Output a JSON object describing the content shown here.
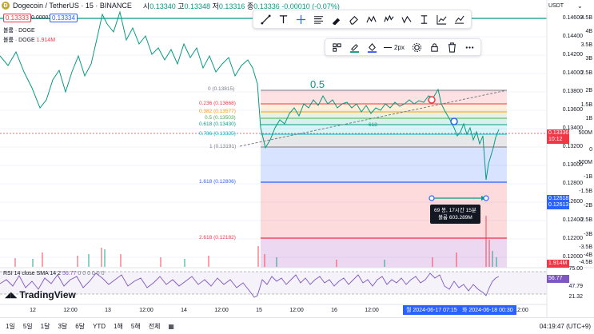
{
  "header": {
    "symbol": "Dogecoin / TetherUS · 15 · BINANCE",
    "open_lbl": "시",
    "open": "0.13340",
    "high_lbl": "고",
    "high": "0.13348",
    "low_lbl": "저",
    "low": "0.13316",
    "close_lbl": "종",
    "close": "0.13336",
    "change": "-0.00010 (-0.07%)",
    "currency": "USDT"
  },
  "prices": {
    "bid": "0.13333",
    "spread": "0.00001",
    "ask": "0.13334"
  },
  "volume_legend": {
    "label1": "볼륨 · DOGE",
    "label2": "볼륨 · DOGE",
    "value": "1.914M"
  },
  "fib_center_label": "0.5",
  "fib_levels": [
    {
      "text": "0 (0.13815)"
    },
    {
      "text": "0.236 (0.13668)"
    },
    {
      "text": "0.382 (0.13577)"
    },
    {
      "text": "0.5 (0.13503)"
    },
    {
      "text": "0.618 (0.13430)"
    },
    {
      "text": "0.786 (0.13325)"
    },
    {
      "text": "1 (0.13191)"
    },
    {
      "text": "1.618 (0.12806)"
    },
    {
      "text": "2.618 (0.12182)"
    }
  ],
  "trend_label": "618",
  "price_axis": [
    "0.14600",
    "0.14400",
    "0.14200",
    "0.14000",
    "0.13800",
    "0.13600",
    "0.13400",
    "0.13200",
    "0.13000",
    "0.12800",
    "0.12600",
    "0.12400",
    "0.12200",
    "0.12000"
  ],
  "volume_axis": [
    "4.5B",
    "4B",
    "3.5B",
    "3B",
    "2.5B",
    "2B",
    "1.5B",
    "1B",
    "500M",
    "0",
    "-500M",
    "-1B",
    "-1.5B",
    "-2B",
    "-2.5B",
    "-3B",
    "-3.5B",
    "-4B",
    "-4.5B"
  ],
  "current_price": {
    "value": "0.13336",
    "countdown": "10:12"
  },
  "range_prices": {
    "top": "0.12618",
    "bottom": "0.12613"
  },
  "volume_tag": "1.914M",
  "measure": {
    "line1": "69 봉, 17시간 15분",
    "line2": "볼륨 603.289M"
  },
  "rsi": {
    "legend": "RSI 14 close SMA 14 2",
    "value": "56.77",
    "zeros": "0  0  0  0  0  0",
    "axis": [
      "75.00",
      "47.79",
      "21.32"
    ],
    "tag": "56.77"
  },
  "x_axis": [
    "12",
    "12:00",
    "13",
    "12:00",
    "14",
    "12:00",
    "15",
    "12:00",
    "16",
    "12:00",
    "12:00"
  ],
  "x_range": {
    "start": "월 2024-06-17  07:15",
    "end": "화 2024-06-18  00:30"
  },
  "bottom_bar": {
    "ranges": [
      "1일",
      "5일",
      "1달",
      "3달",
      "6달",
      "YTD",
      "1해",
      "5해",
      "전체"
    ],
    "clock": "04:19:47 (UTC+9)"
  },
  "brand": "TradingView",
  "colors": {
    "up": "#089981",
    "down": "#f23645",
    "accent": "#2962ff",
    "rsi": "#7e57c2"
  }
}
